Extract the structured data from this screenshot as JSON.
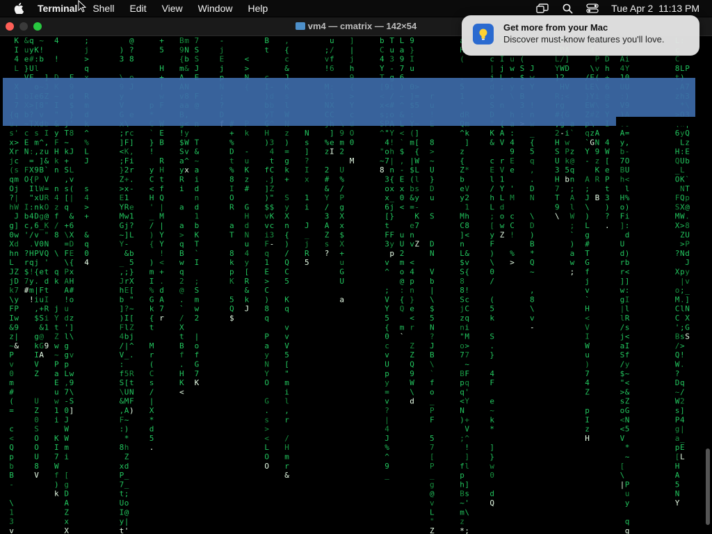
{
  "menubar": {
    "app_name": "Terminal",
    "menus": [
      "Shell",
      "Edit",
      "View",
      "Window",
      "Help"
    ],
    "clock": "Tue Apr 2  11:13 PM",
    "icons": [
      "apple-icon",
      "screen-mirroring-icon",
      "spotlight-search-icon",
      "control-center-icon"
    ]
  },
  "window": {
    "title": "vm4 — cmatrix — 142×54"
  },
  "notification": {
    "title": "Get more from your Mac",
    "body": "Discover must-know features you'll love."
  },
  "matrix": {
    "bright_color": "#e8ffe8",
    "text_color": "#22c55e",
    "dim_color": "#17903f",
    "selection_color": "#3d6aa8",
    "columns": [
      "zyAXeraE7i6",
      "Il@@5?7I\"5",
      "mmRbzqh$LFLLe",
      "&7P8l\"",
      "D$:%8\"Q"
    ]
  }
}
